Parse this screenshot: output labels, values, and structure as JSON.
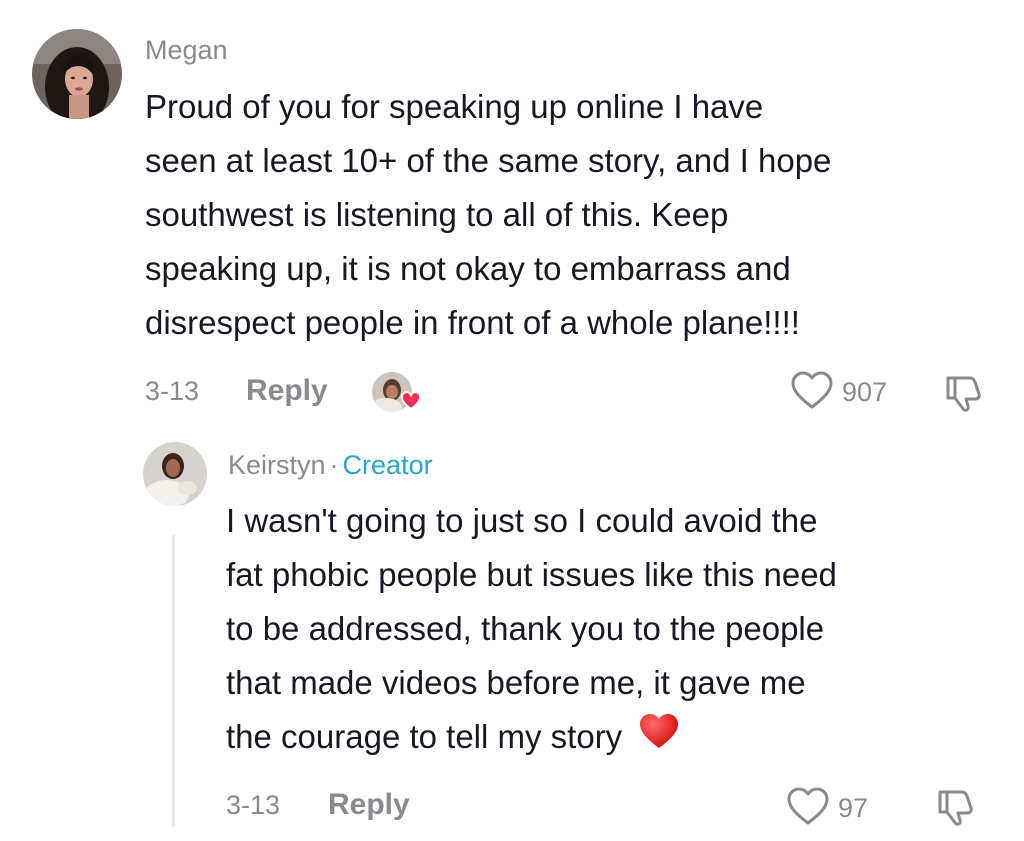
{
  "comments": [
    {
      "username": "Megan",
      "text_lines": [
        "Proud of you for speaking up online I have",
        "seen at least 10+ of the same story, and I hope",
        "southwest is listening to all of this. Keep",
        "speaking up, it is not okay to embarrass and",
        "disrespect people in front of a whole plane!!!!"
      ],
      "date": "3-13",
      "reply_label": "Reply",
      "likes": "907",
      "creator_liked": true
    }
  ],
  "reply": {
    "username": "Keirstyn",
    "separator": "·",
    "badge": "Creator",
    "text_lines": [
      "I wasn't going to just so I could avoid the",
      "fat phobic people but issues like this need",
      "to be addressed, thank you to the people",
      "that made videos before me, it gave me",
      "the courage to tell my story"
    ],
    "emoji": "red-heart",
    "date": "3-13",
    "reply_label": "Reply",
    "likes": "97"
  },
  "colors": {
    "text": "#161823",
    "muted": "#8a8a8e",
    "creator": "#2aa6c9",
    "heart": "#fe2c55"
  },
  "icons": [
    "heart-outline-icon",
    "dislike-icon",
    "creator-liked-badge",
    "red-heart-emoji"
  ]
}
